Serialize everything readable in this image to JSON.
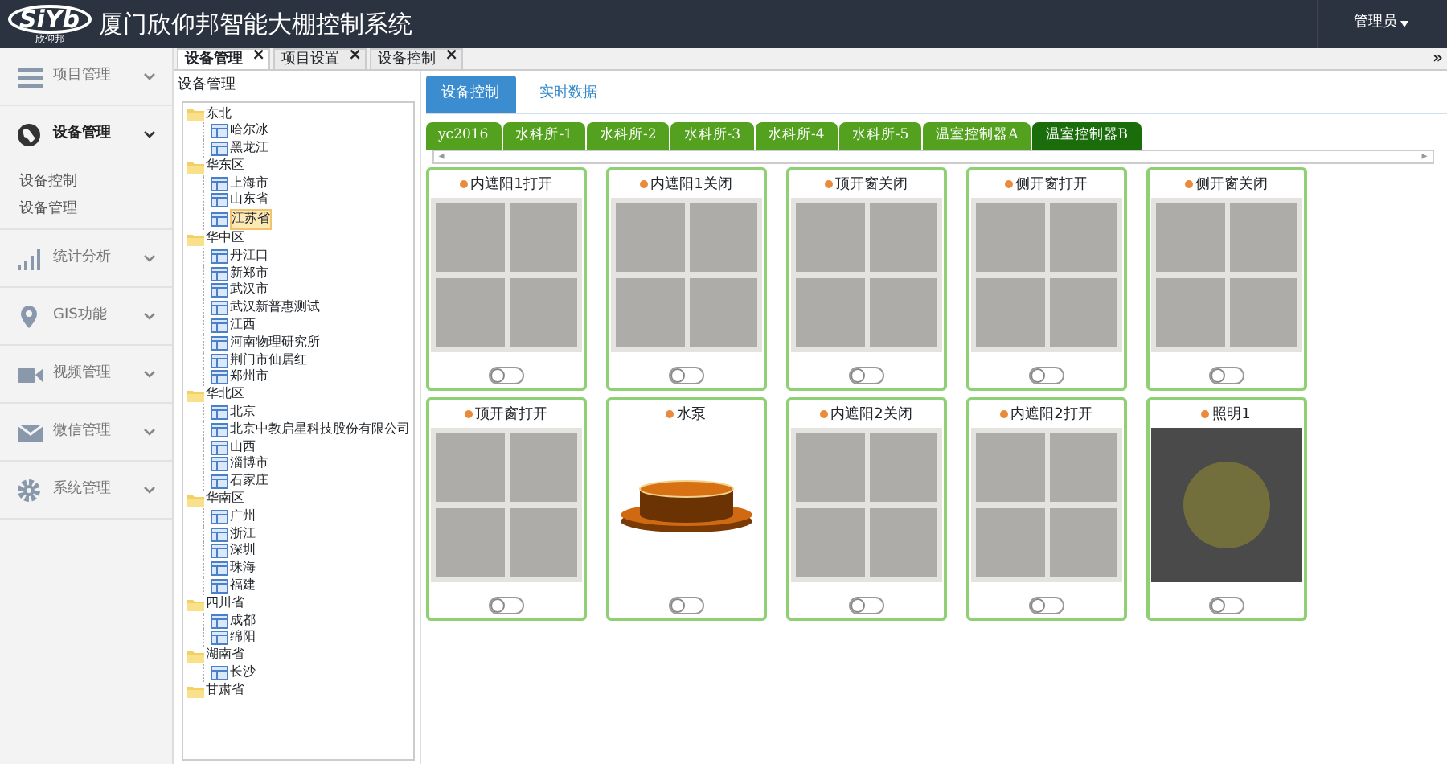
{
  "header": {
    "logo": "SiYb",
    "logo_sub": "欣仰邦",
    "title": "厦门欣仰邦智能大棚控制系统",
    "user": "管理员"
  },
  "sidebar": {
    "items": [
      {
        "label": "项目管理",
        "expanded": false
      },
      {
        "label": "设备管理",
        "expanded": true,
        "children": [
          {
            "label": "设备控制"
          },
          {
            "label": "设备管理"
          }
        ]
      },
      {
        "label": "统计分析",
        "expanded": false
      },
      {
        "label": "GIS功能",
        "expanded": false
      },
      {
        "label": "视频管理",
        "expanded": false
      },
      {
        "label": "微信管理",
        "expanded": false
      },
      {
        "label": "系统管理",
        "expanded": false
      }
    ]
  },
  "page_tabs": [
    {
      "label": "设备管理",
      "selected": true,
      "close": "×"
    },
    {
      "label": "项目设置",
      "selected": false,
      "close": "×"
    },
    {
      "label": "设备控制",
      "selected": false,
      "close": "×"
    }
  ],
  "collapse_toggle": "»",
  "tree": {
    "title": "设备管理",
    "nodes": [
      {
        "label": "东北",
        "children": [
          {
            "label": "哈尔冰",
            "selected": false
          },
          {
            "label": "黑龙江",
            "selected": false
          }
        ]
      },
      {
        "label": "华东区",
        "children": [
          {
            "label": "上海市",
            "selected": false
          },
          {
            "label": "山东省",
            "selected": false
          },
          {
            "label": "江苏省",
            "selected": true
          }
        ]
      },
      {
        "label": "华中区",
        "children": [
          {
            "label": "丹江口",
            "selected": false
          },
          {
            "label": "新郑市",
            "selected": false
          },
          {
            "label": "武汉市",
            "selected": false
          },
          {
            "label": "武汉新普惠测试",
            "selected": false
          },
          {
            "label": "江西",
            "selected": false
          },
          {
            "label": "河南物理研究所",
            "selected": false
          },
          {
            "label": "荆门市仙居红",
            "selected": false
          },
          {
            "label": "郑州市",
            "selected": false
          }
        ]
      },
      {
        "label": "华北区",
        "children": [
          {
            "label": "北京",
            "selected": false
          },
          {
            "label": "北京中教启星科技股份有限公司",
            "selected": false
          },
          {
            "label": "山西",
            "selected": false
          },
          {
            "label": "淄博市",
            "selected": false
          },
          {
            "label": "石家庄",
            "selected": false
          }
        ]
      },
      {
        "label": "华南区",
        "children": [
          {
            "label": "广州",
            "selected": false
          },
          {
            "label": "浙江",
            "selected": false
          },
          {
            "label": "深圳",
            "selected": false
          },
          {
            "label": "珠海",
            "selected": false
          },
          {
            "label": "福建",
            "selected": false
          }
        ]
      },
      {
        "label": "四川省",
        "children": [
          {
            "label": "成都",
            "selected": false
          },
          {
            "label": "绵阳",
            "selected": false
          }
        ]
      },
      {
        "label": "湖南省",
        "children": [
          {
            "label": "长沙",
            "selected": false
          }
        ]
      },
      {
        "label": "甘肃省"
      }
    ]
  },
  "view_tabs": [
    {
      "label": "设备控制",
      "selected": true
    },
    {
      "label": "实时数据",
      "selected": false
    }
  ],
  "controller_tabs": [
    {
      "label": "yc2016",
      "selected": false
    },
    {
      "label": "水科所-1",
      "selected": false
    },
    {
      "label": "水科所-2",
      "selected": false
    },
    {
      "label": "水科所-3",
      "selected": false
    },
    {
      "label": "水科所-4",
      "selected": false
    },
    {
      "label": "水科所-5",
      "selected": false
    },
    {
      "label": "温室控制器A",
      "selected": false
    },
    {
      "label": "温室控制器B",
      "selected": true
    }
  ],
  "scroll_arrows": {
    "left": "◂",
    "right": "▸"
  },
  "devices": [
    {
      "name": "内遮阳1打开",
      "kind": "window",
      "on": false
    },
    {
      "name": "内遮阳1关闭",
      "kind": "window",
      "on": false
    },
    {
      "name": "顶开窗关闭",
      "kind": "window",
      "on": false
    },
    {
      "name": "侧开窗打开",
      "kind": "window",
      "on": false
    },
    {
      "name": "侧开窗关闭",
      "kind": "window",
      "on": false
    },
    {
      "name": "顶开窗打开",
      "kind": "window",
      "on": false
    },
    {
      "name": "水泵",
      "kind": "pump",
      "on": false
    },
    {
      "name": "内遮阳2关闭",
      "kind": "window",
      "on": false
    },
    {
      "name": "内遮阳2打开",
      "kind": "window",
      "on": false
    },
    {
      "name": "照明1",
      "kind": "light",
      "on": false
    }
  ]
}
